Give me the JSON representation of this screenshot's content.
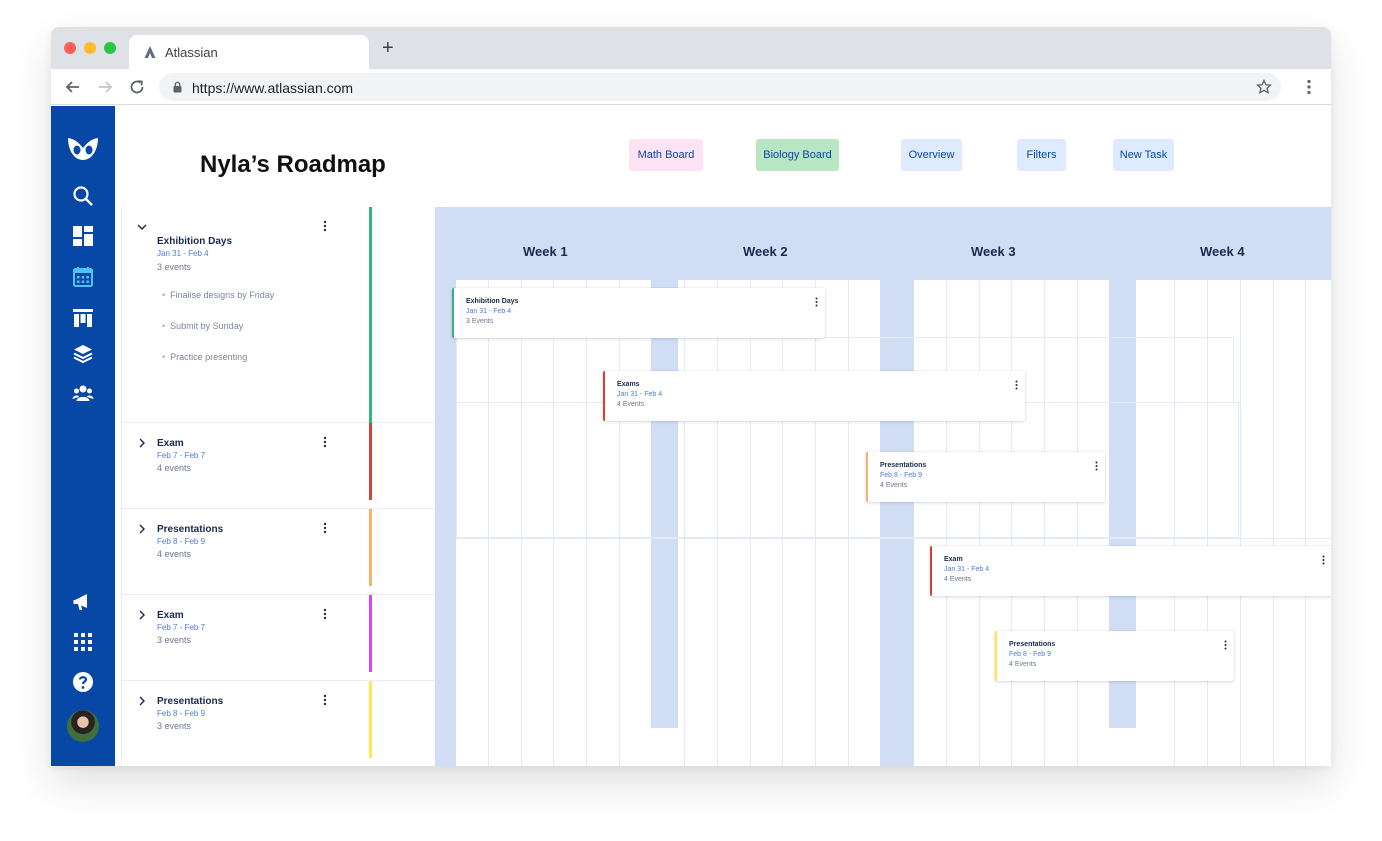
{
  "browser": {
    "tab_title": "Atlassian",
    "new_tab_symbol": "+",
    "url": "https://www.atlassian.com"
  },
  "sidebar": {
    "top_icons": [
      "logo-icon",
      "search-icon",
      "dashboard-icon",
      "calendar-icon",
      "board-icon",
      "layers-icon",
      "people-icon"
    ],
    "bottom_icons": [
      "megaphone-icon",
      "apps-grid-icon",
      "help-icon",
      "avatar"
    ],
    "active": "calendar-icon"
  },
  "header": {
    "title": "Nyla’s Roadmap",
    "buttons": [
      {
        "label": "Math Board",
        "bg": "#ffe3f5"
      },
      {
        "label": "Biology Board",
        "bg": "#b9e6c2"
      },
      {
        "label": "Overview",
        "bg": "#deebff"
      },
      {
        "label": "Filters",
        "bg": "#deebff"
      },
      {
        "label": "New Task",
        "bg": "#deebff"
      }
    ]
  },
  "epics": [
    {
      "name": "Exhibition Days",
      "dates": "Jan 31 - Feb 4",
      "count": "3 events",
      "color": "#36b37e",
      "expanded": true,
      "subtasks": [
        "Finalise designs by Friday",
        "Submit by Sunday",
        "Practice presenting"
      ]
    },
    {
      "name": "Exam",
      "dates": "Feb 7 - Feb 7",
      "count": "4 events",
      "color": "#d04437",
      "expanded": false
    },
    {
      "name": "Presentations",
      "dates": "Feb 8 - Feb 9",
      "count": "4 events",
      "color": "#f6b26b",
      "expanded": false
    },
    {
      "name": "Exam",
      "dates": "Feb 7 - Feb 7",
      "count": "3 events",
      "color": "#e040fb",
      "expanded": false
    },
    {
      "name": "Presentations",
      "dates": "Feb 8 - Feb 9",
      "count": "3 events",
      "color": "#ffe94d",
      "expanded": false
    }
  ],
  "timeline": {
    "weeks": [
      "Week 1",
      "Week 2",
      "Week 3",
      "Week 4"
    ],
    "cards": [
      {
        "name": "Exhibition Days",
        "dates": "Jan 31 - Feb 4",
        "count": "3 Events",
        "color": "#36b37e"
      },
      {
        "name": "Exams",
        "dates": "Jan 31 - Feb 4",
        "count": "4 Events",
        "color": "#d04437"
      },
      {
        "name": "Presentations",
        "dates": "Feb 8 - Feb 9",
        "count": "4 Events",
        "color": "#f6b26b"
      },
      {
        "name": "Exam",
        "dates": "Jan 31 - Feb 4",
        "count": "4 Events",
        "color": "#d04437"
      },
      {
        "name": "Presentations",
        "dates": "Feb 8 - Feb 9",
        "count": "4 Events",
        "color": "#ffe94d"
      }
    ]
  }
}
